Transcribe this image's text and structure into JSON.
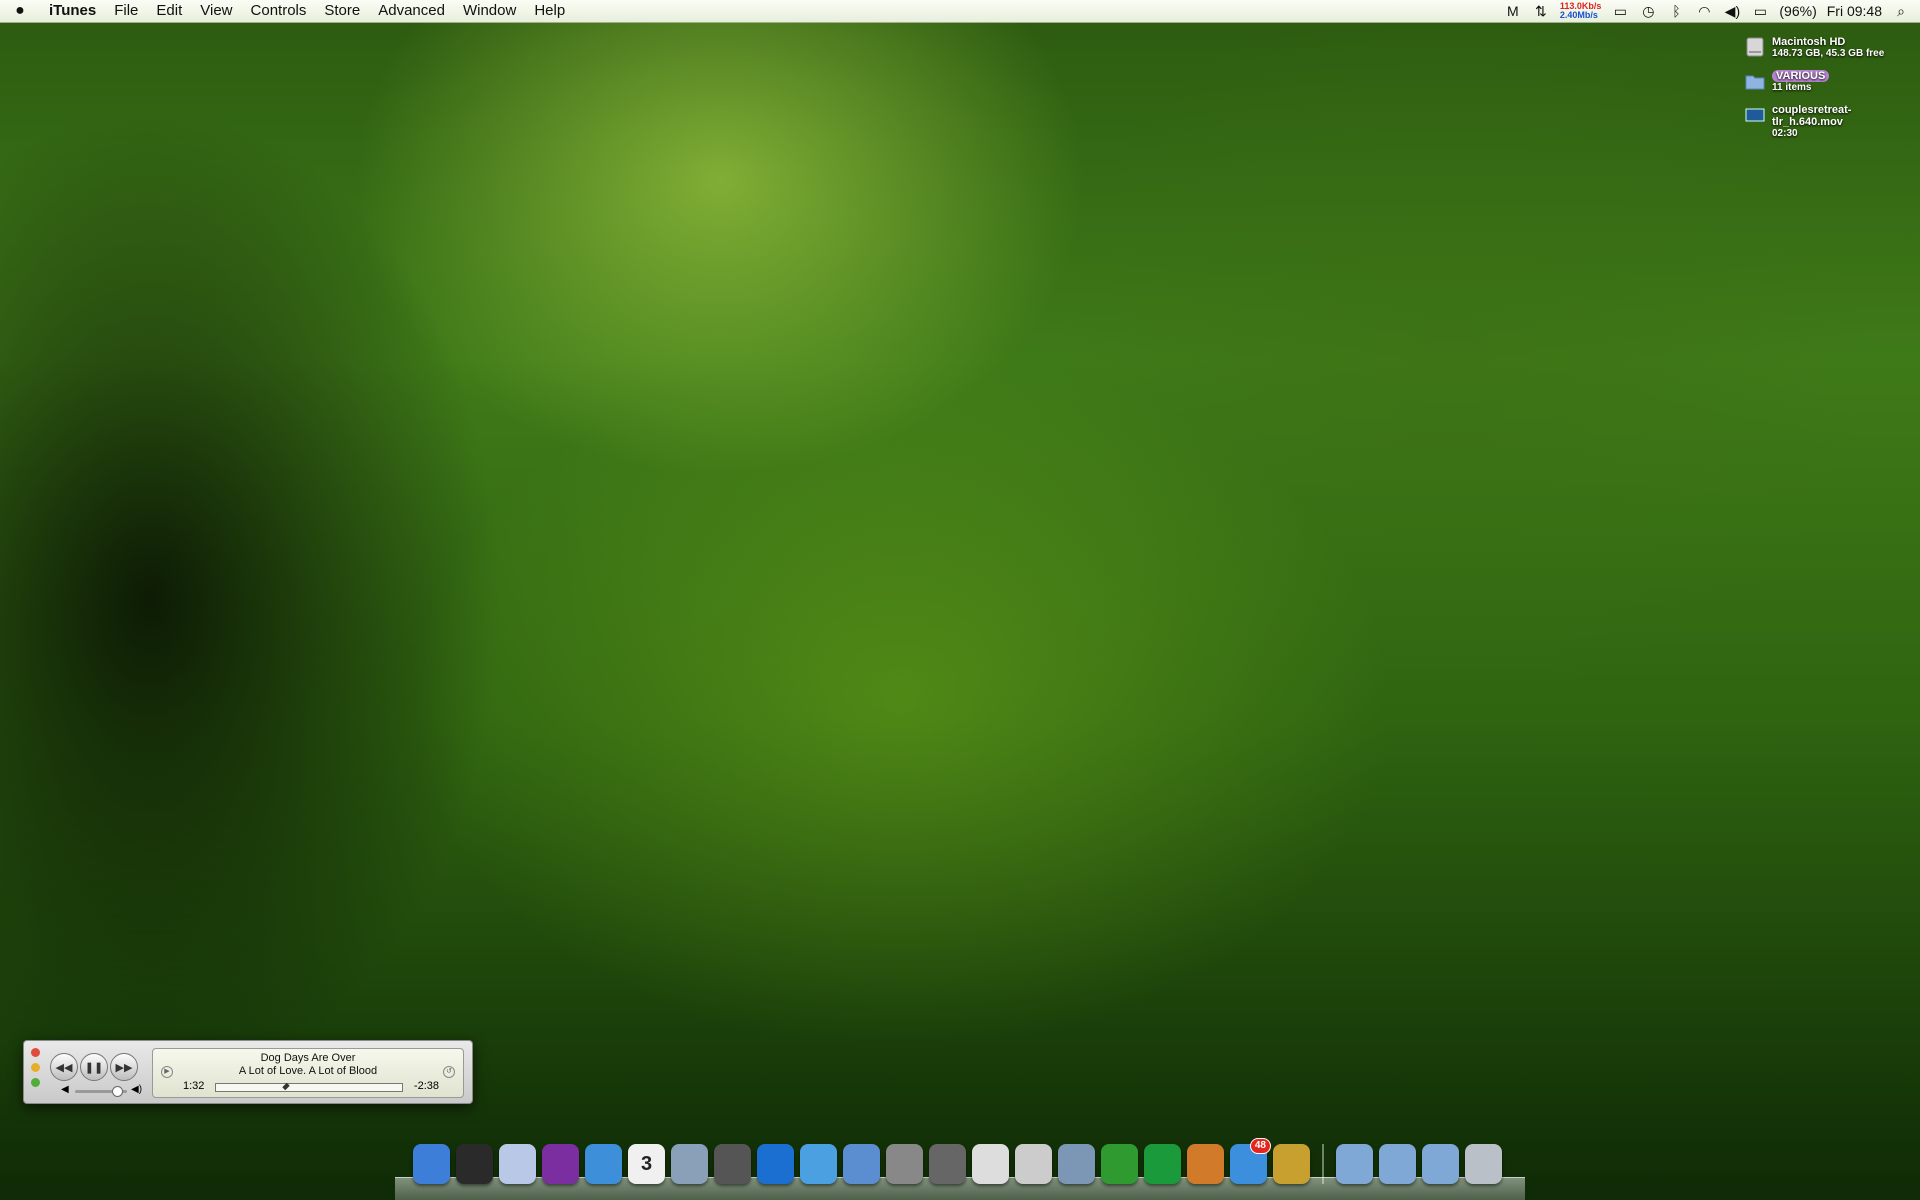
{
  "menubar": {
    "app_name": "iTunes",
    "menus": [
      "File",
      "Edit",
      "View",
      "Controls",
      "Store",
      "Advanced",
      "Window",
      "Help"
    ],
    "net_up": "113.0Kb/s",
    "net_down": "2.40Mb/s",
    "battery": "(96%)",
    "clock": "Fri 09:48"
  },
  "desktop": {
    "items": [
      {
        "name": "Macintosh HD",
        "sub": "148.73 GB, 45.3 GB free",
        "icon": "hard-drive-icon"
      },
      {
        "name": "VARIOUS",
        "sub": "11 items",
        "icon": "folder-icon",
        "label_color": "#b782d0"
      },
      {
        "name": "couplesretreat-tlr_h.640.mov",
        "sub": "02:30",
        "icon": "movie-file-icon"
      }
    ]
  },
  "player": {
    "song": "Dog Days Are Over",
    "album": "A Lot of Love. A Lot of Blood",
    "elapsed": "1:32",
    "remaining": "-2:38",
    "progress": 0.37,
    "volume": 0.78
  },
  "dock": {
    "apps": [
      {
        "icon": "finder-icon",
        "color": "#3d7fd8"
      },
      {
        "icon": "dashboard-icon",
        "color": "#2a2a2a"
      },
      {
        "icon": "mail-icon",
        "color": "#b9c8e6"
      },
      {
        "icon": "adium-icon",
        "color": "#7a2ea0"
      },
      {
        "icon": "safari-icon",
        "color": "#3c8fd8"
      },
      {
        "icon": "ical-icon",
        "color": "#f0f0f0",
        "text": "3"
      },
      {
        "icon": "iphoto-icon",
        "color": "#8aa0b8"
      },
      {
        "icon": "front-row-icon",
        "color": "#555"
      },
      {
        "icon": "quicktime-icon",
        "color": "#1a6fd1"
      },
      {
        "icon": "itunes-icon",
        "color": "#4aa0e0"
      },
      {
        "icon": "disk-utility-icon",
        "color": "#5b8ed0"
      },
      {
        "icon": "system-preferences-icon",
        "color": "#888"
      },
      {
        "icon": "network-utility-icon",
        "color": "#666"
      },
      {
        "icon": "textedit-icon",
        "color": "#ddd"
      },
      {
        "icon": "transmission-icon",
        "color": "#ccc"
      },
      {
        "icon": "preview-icon",
        "color": "#7c97b5"
      },
      {
        "icon": "leaf-app-icon",
        "color": "#2f9a2f"
      },
      {
        "icon": "x-app-icon",
        "color": "#1a9a3a"
      },
      {
        "icon": "grid-app-icon",
        "color": "#d07a2a"
      },
      {
        "icon": "messenger-icon",
        "color": "#3b8fdc",
        "badge": "48"
      },
      {
        "icon": "downloads-stack-icon",
        "color": "#c8a030"
      }
    ],
    "stacks": [
      {
        "icon": "documents-folder-icon",
        "color": "#7fa8d6"
      },
      {
        "icon": "downloads-folder-icon",
        "color": "#7fa8d6"
      },
      {
        "icon": "applications-folder-icon",
        "color": "#7fa8d6"
      },
      {
        "icon": "trash-icon",
        "color": "#b9c0c8"
      }
    ]
  }
}
